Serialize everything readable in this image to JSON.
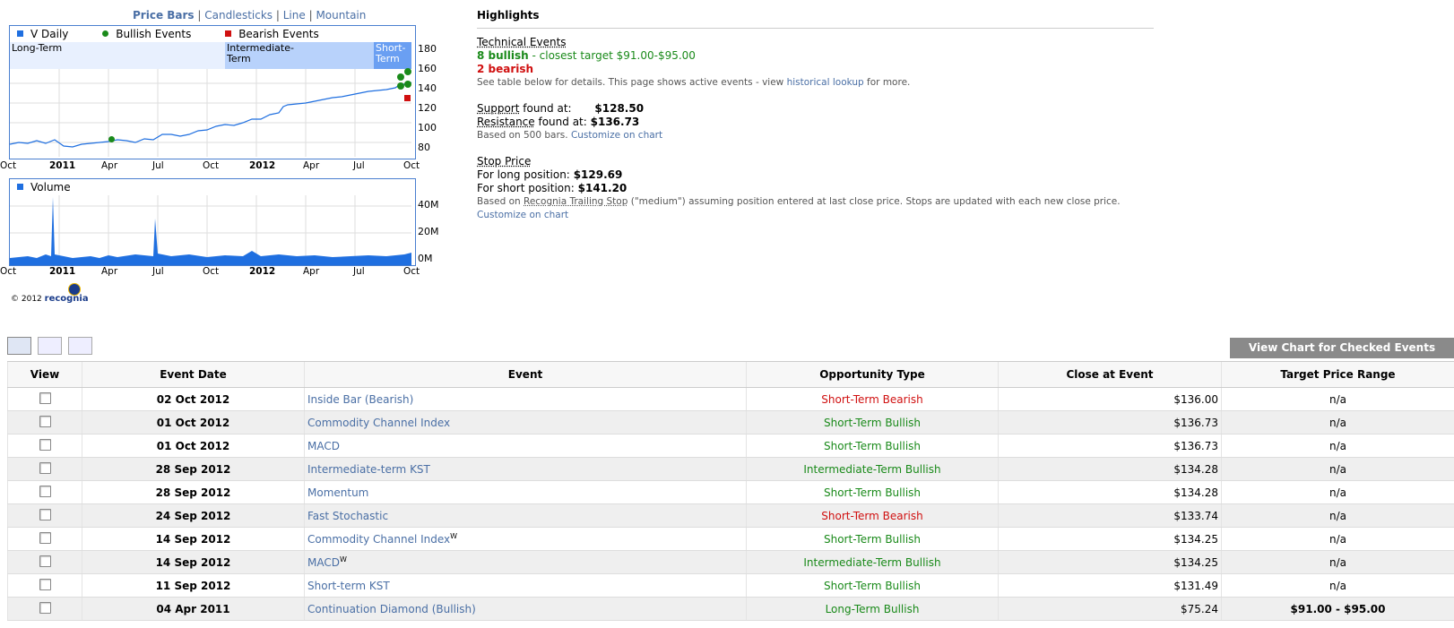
{
  "chart_tabs": [
    "Price Bars",
    "Candlesticks",
    "Line",
    "Mountain"
  ],
  "price_chart": {
    "legend": [
      "V Daily",
      "Bullish Events",
      "Bearish Events"
    ],
    "terms": [
      "Long-Term",
      "Intermediate-Term",
      "Short-Term"
    ],
    "y_ticks": [
      "180",
      "160",
      "140",
      "120",
      "100",
      "80"
    ],
    "x_ticks": [
      "Oct",
      "2011",
      "Apr",
      "Jul",
      "Oct",
      "2012",
      "Apr",
      "Jul",
      "Oct"
    ]
  },
  "volume_chart": {
    "legend": "Volume",
    "y_ticks": [
      "40M",
      "20M",
      "0M"
    ],
    "x_ticks": [
      "Oct",
      "2011",
      "Apr",
      "Jul",
      "Oct",
      "2012",
      "Apr",
      "Jul",
      "Oct"
    ]
  },
  "copyright": "© 2012",
  "brand": "recognia",
  "highlights": {
    "title": "Highlights",
    "technical_events_label": "Technical Events",
    "bullish_count": "8 bullish",
    "closest_target": " - closest target $91.00-$95.00",
    "bearish_count": "2 bearish",
    "details_note_pre": "See table below for details. This page shows active events - view ",
    "details_note_link": "historical lookup",
    "details_note_post": " for more.",
    "support_label": "Support",
    "support_text": " found at:",
    "support_value": "$128.50",
    "resistance_label": "Resistance",
    "resistance_text": " found at:",
    "resistance_value": "$136.73",
    "bars_note": "Based on 500 bars.",
    "customize_link": "Customize on chart",
    "stop_label": "Stop Price",
    "long_text": "For long position:",
    "long_value": "$129.69",
    "short_text": "For short position:",
    "short_value": "$141.20",
    "stop_note_pre": "Based on ",
    "stop_note_link": "Recognia Trailing Stop",
    "stop_note_post": " (\"medium\") assuming position entered at last close price. Stops are updated with each new close price.",
    "stop_customize_link": "Customize on chart"
  },
  "view_button": "View Chart for Checked Events",
  "table": {
    "headers": [
      "View",
      "Event Date",
      "Event",
      "Opportunity Type",
      "Close at Event",
      "Target Price Range"
    ],
    "rows": [
      {
        "date": "02 Oct 2012",
        "event": "Inside Bar (Bearish)",
        "sup": "",
        "type": "Short-Term Bearish",
        "close": "$136.00",
        "target": "n/a"
      },
      {
        "date": "01 Oct 2012",
        "event": "Commodity Channel Index",
        "sup": "",
        "type": "Short-Term Bullish",
        "close": "$136.73",
        "target": "n/a"
      },
      {
        "date": "01 Oct 2012",
        "event": "MACD",
        "sup": "",
        "type": "Short-Term Bullish",
        "close": "$136.73",
        "target": "n/a"
      },
      {
        "date": "28 Sep 2012",
        "event": "Intermediate-term KST",
        "sup": "",
        "type": "Intermediate-Term Bullish",
        "close": "$134.28",
        "target": "n/a"
      },
      {
        "date": "28 Sep 2012",
        "event": "Momentum",
        "sup": "",
        "type": "Short-Term Bullish",
        "close": "$134.28",
        "target": "n/a"
      },
      {
        "date": "24 Sep 2012",
        "event": "Fast Stochastic",
        "sup": "",
        "type": "Short-Term Bearish",
        "close": "$133.74",
        "target": "n/a"
      },
      {
        "date": "14 Sep 2012",
        "event": "Commodity Channel Index",
        "sup": "W",
        "type": "Short-Term Bullish",
        "close": "$134.25",
        "target": "n/a"
      },
      {
        "date": "14 Sep 2012",
        "event": "MACD",
        "sup": "W",
        "type": "Intermediate-Term Bullish",
        "close": "$134.25",
        "target": "n/a"
      },
      {
        "date": "11 Sep 2012",
        "event": "Short-term KST",
        "sup": "",
        "type": "Short-Term Bullish",
        "close": "$131.49",
        "target": "n/a"
      },
      {
        "date": "04 Apr 2011",
        "event": "Continuation Diamond (Bullish)",
        "sup": "",
        "type": "Long-Term Bullish",
        "close": "$75.24",
        "target": "$91.00 - $95.00"
      }
    ]
  },
  "colors": {
    "bullish": "#1a8a1a",
    "bearish": "#d01010",
    "link": "#4a6fa5",
    "series": "#1f6fe0"
  }
}
